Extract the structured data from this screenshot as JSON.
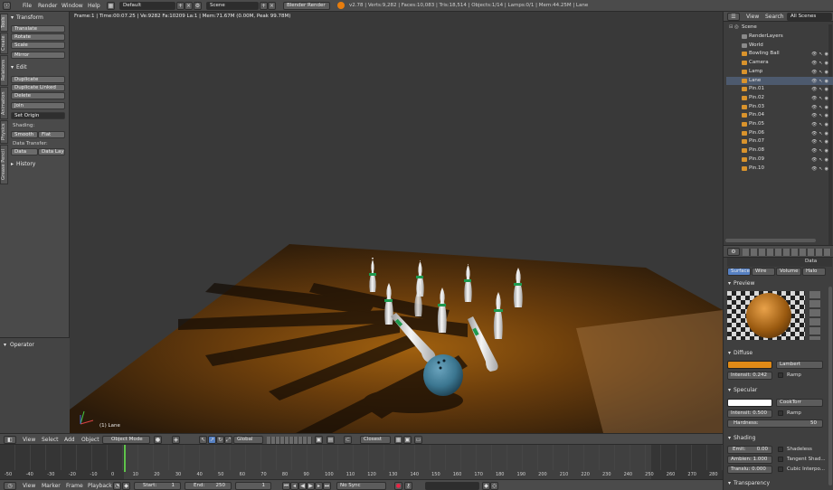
{
  "info_bar": {
    "menus": [
      "File",
      "Render",
      "Window",
      "Help"
    ],
    "screen_layout": "Default",
    "scene": "Scene",
    "render_engine": "Blender Render",
    "stats": "v2.78 | Verts:9,282 | Faces:10,083 | Tris:18,514 | Objects:1/14 | Lamps:0/1 | Mem:44.25M | Lane"
  },
  "viewport": {
    "header_text": "Frame:1 | Time:00:07.25 | Ve:9282 Fa:10209 La:1 | Mem:71.67M (0.00M, Peak 99.78M)",
    "object_label": "(1) Lane",
    "colors": {
      "background": "#3a3a3a",
      "lane": "#7a4710",
      "pin": "#e6e6e6",
      "stripe": "#1f9a4f",
      "ball": "#3f7a95"
    }
  },
  "toolshelf": {
    "tabs": [
      "Tools",
      "Create",
      "Relations",
      "Animation",
      "Physics",
      "Grease Pencil"
    ],
    "transform": {
      "title": "Transform",
      "buttons": [
        "Translate",
        "Rotate",
        "Scale",
        "Mirror"
      ]
    },
    "edit": {
      "title": "Edit",
      "buttons": [
        "Duplicate",
        "Duplicate Linked",
        "Delete",
        "Join"
      ],
      "set_origin": "Set Origin"
    },
    "shading": {
      "label": "Shading:",
      "smooth": "Smooth",
      "flat": "Flat"
    },
    "data_transfer": {
      "label": "Data Transfer:",
      "data": "Data",
      "data_layout": "Data Layo"
    },
    "history": "History",
    "operator": "Operator"
  },
  "view3d_header": {
    "menus": [
      "View",
      "Select",
      "Add",
      "Object"
    ],
    "mode": "Object Mode",
    "orientation": "Global",
    "snap": "Closest"
  },
  "timeline": {
    "ticks": [
      "-50",
      "-40",
      "-30",
      "-20",
      "-10",
      "0",
      "10",
      "20",
      "30",
      "40",
      "50",
      "60",
      "70",
      "80",
      "90",
      "100",
      "110",
      "120",
      "130",
      "140",
      "150",
      "160",
      "170",
      "180",
      "190",
      "200",
      "210",
      "220",
      "230",
      "240",
      "250",
      "260",
      "270",
      "280"
    ],
    "menus": [
      "View",
      "Marker",
      "Frame",
      "Playback"
    ],
    "start": "Start:",
    "start_val": "1",
    "end": "End:",
    "end_val": "250",
    "current_frame": "1",
    "sync": "No Sync"
  },
  "outliner": {
    "menus": [
      "View",
      "Search"
    ],
    "filter": "All Scenes",
    "scene": "Scene",
    "items": [
      "RenderLayers",
      "World",
      "Bowling Ball",
      "Camera",
      "Lamp",
      "Lane",
      "Pin.01",
      "Pin.02",
      "Pin.03",
      "Pin.04",
      "Pin.05",
      "Pin.06",
      "Pin.07",
      "Pin.08",
      "Pin.09",
      "Pin.10"
    ]
  },
  "properties": {
    "material_tabs": [
      "Surface",
      "Wire",
      "Volume",
      "Halo"
    ],
    "data_label": "Data",
    "preview": "Preview",
    "diffuse": {
      "title": "Diffuse",
      "color": "#e08a17",
      "shader": "Lambert",
      "intensity": "Intensit: 0.242",
      "ramp": "Ramp"
    },
    "specular": {
      "title": "Specular",
      "color": "#ffffff",
      "shader": "CookTorr",
      "intensity": "Intensit: 0.500",
      "ramp": "Ramp",
      "hardness": "Hardness:",
      "hardness_val": "50"
    },
    "shading": {
      "title": "Shading",
      "emit": "Emit:",
      "emit_val": "0.00",
      "ambient": "Ambien: 1.000",
      "translucency": "Translu: 0.000",
      "shadeless": "Shadeless",
      "tangent": "Tangent Shad...",
      "cubic": "Cubic Interpo..."
    },
    "transparency": "Transparency"
  }
}
